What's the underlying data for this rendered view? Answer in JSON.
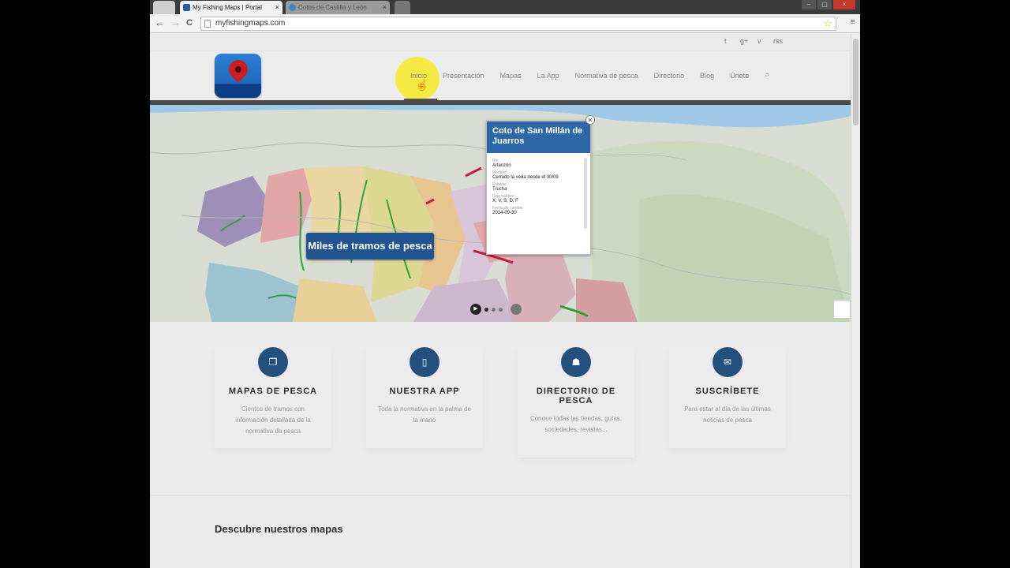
{
  "browser": {
    "tabs": [
      {
        "label": "My Fishing Maps | Portal",
        "close": "×"
      },
      {
        "label": "Cotos de Castilla y León",
        "close": "×"
      }
    ],
    "url": "myfishingmaps.com",
    "back": "←",
    "forward": "→",
    "reload": "C",
    "star": "☆",
    "menu": "≡",
    "window_controls": [
      "–",
      "▢",
      "×"
    ]
  },
  "social": [
    "t",
    "g+",
    "v",
    "rss"
  ],
  "nav": {
    "items": [
      "Inicio",
      "Presentación",
      "Mapas",
      "La App",
      "Normativa de pesca",
      "Directorio",
      "Blog",
      "Únete"
    ],
    "search_icon": "⌕"
  },
  "slider": {
    "caption": "Miles de tramos de pesca",
    "popup": {
      "title": "Coto de San Millán de Juarros",
      "close": "×",
      "fields": [
        {
          "label": "Rio",
          "value": "Arlanzón"
        },
        {
          "label": "Modalid.",
          "value": "Cerrado la veda desde el 30/09"
        },
        {
          "label": "Especie",
          "value": "Trucha"
        },
        {
          "label": "Dias habiles",
          "value": "X, V, S, D, F"
        },
        {
          "label": "Fecha de cambio",
          "value": "2014-09-30"
        }
      ]
    },
    "play": "▶"
  },
  "features": [
    {
      "icon": "map-book-icon",
      "glyph": "❐",
      "title": "MAPAS DE PESCA",
      "desc": "Cientos de tramos con información detallada de la normativa de pesca"
    },
    {
      "icon": "phone-icon",
      "glyph": "▯",
      "title": "NUESTRA APP",
      "desc": "Toda la normativa en la palma de la mano"
    },
    {
      "icon": "users-icon",
      "glyph": "☗",
      "title": "DIRECTORIO DE PESCA",
      "desc": "Conoce todas las tiendas, guías, sociedades, revistas..."
    },
    {
      "icon": "mail-icon",
      "glyph": "✉",
      "title": "SUSCRÍBETE",
      "desc": "Para estar al día de las últimas noticias de pesca"
    }
  ],
  "section_title": "Descubre nuestros mapas",
  "colors": {
    "accent": "#25507d",
    "popup_header": "#2e67a8",
    "caption_bg": "#1f5491",
    "cursor_highlight": "#f6ea3a"
  }
}
